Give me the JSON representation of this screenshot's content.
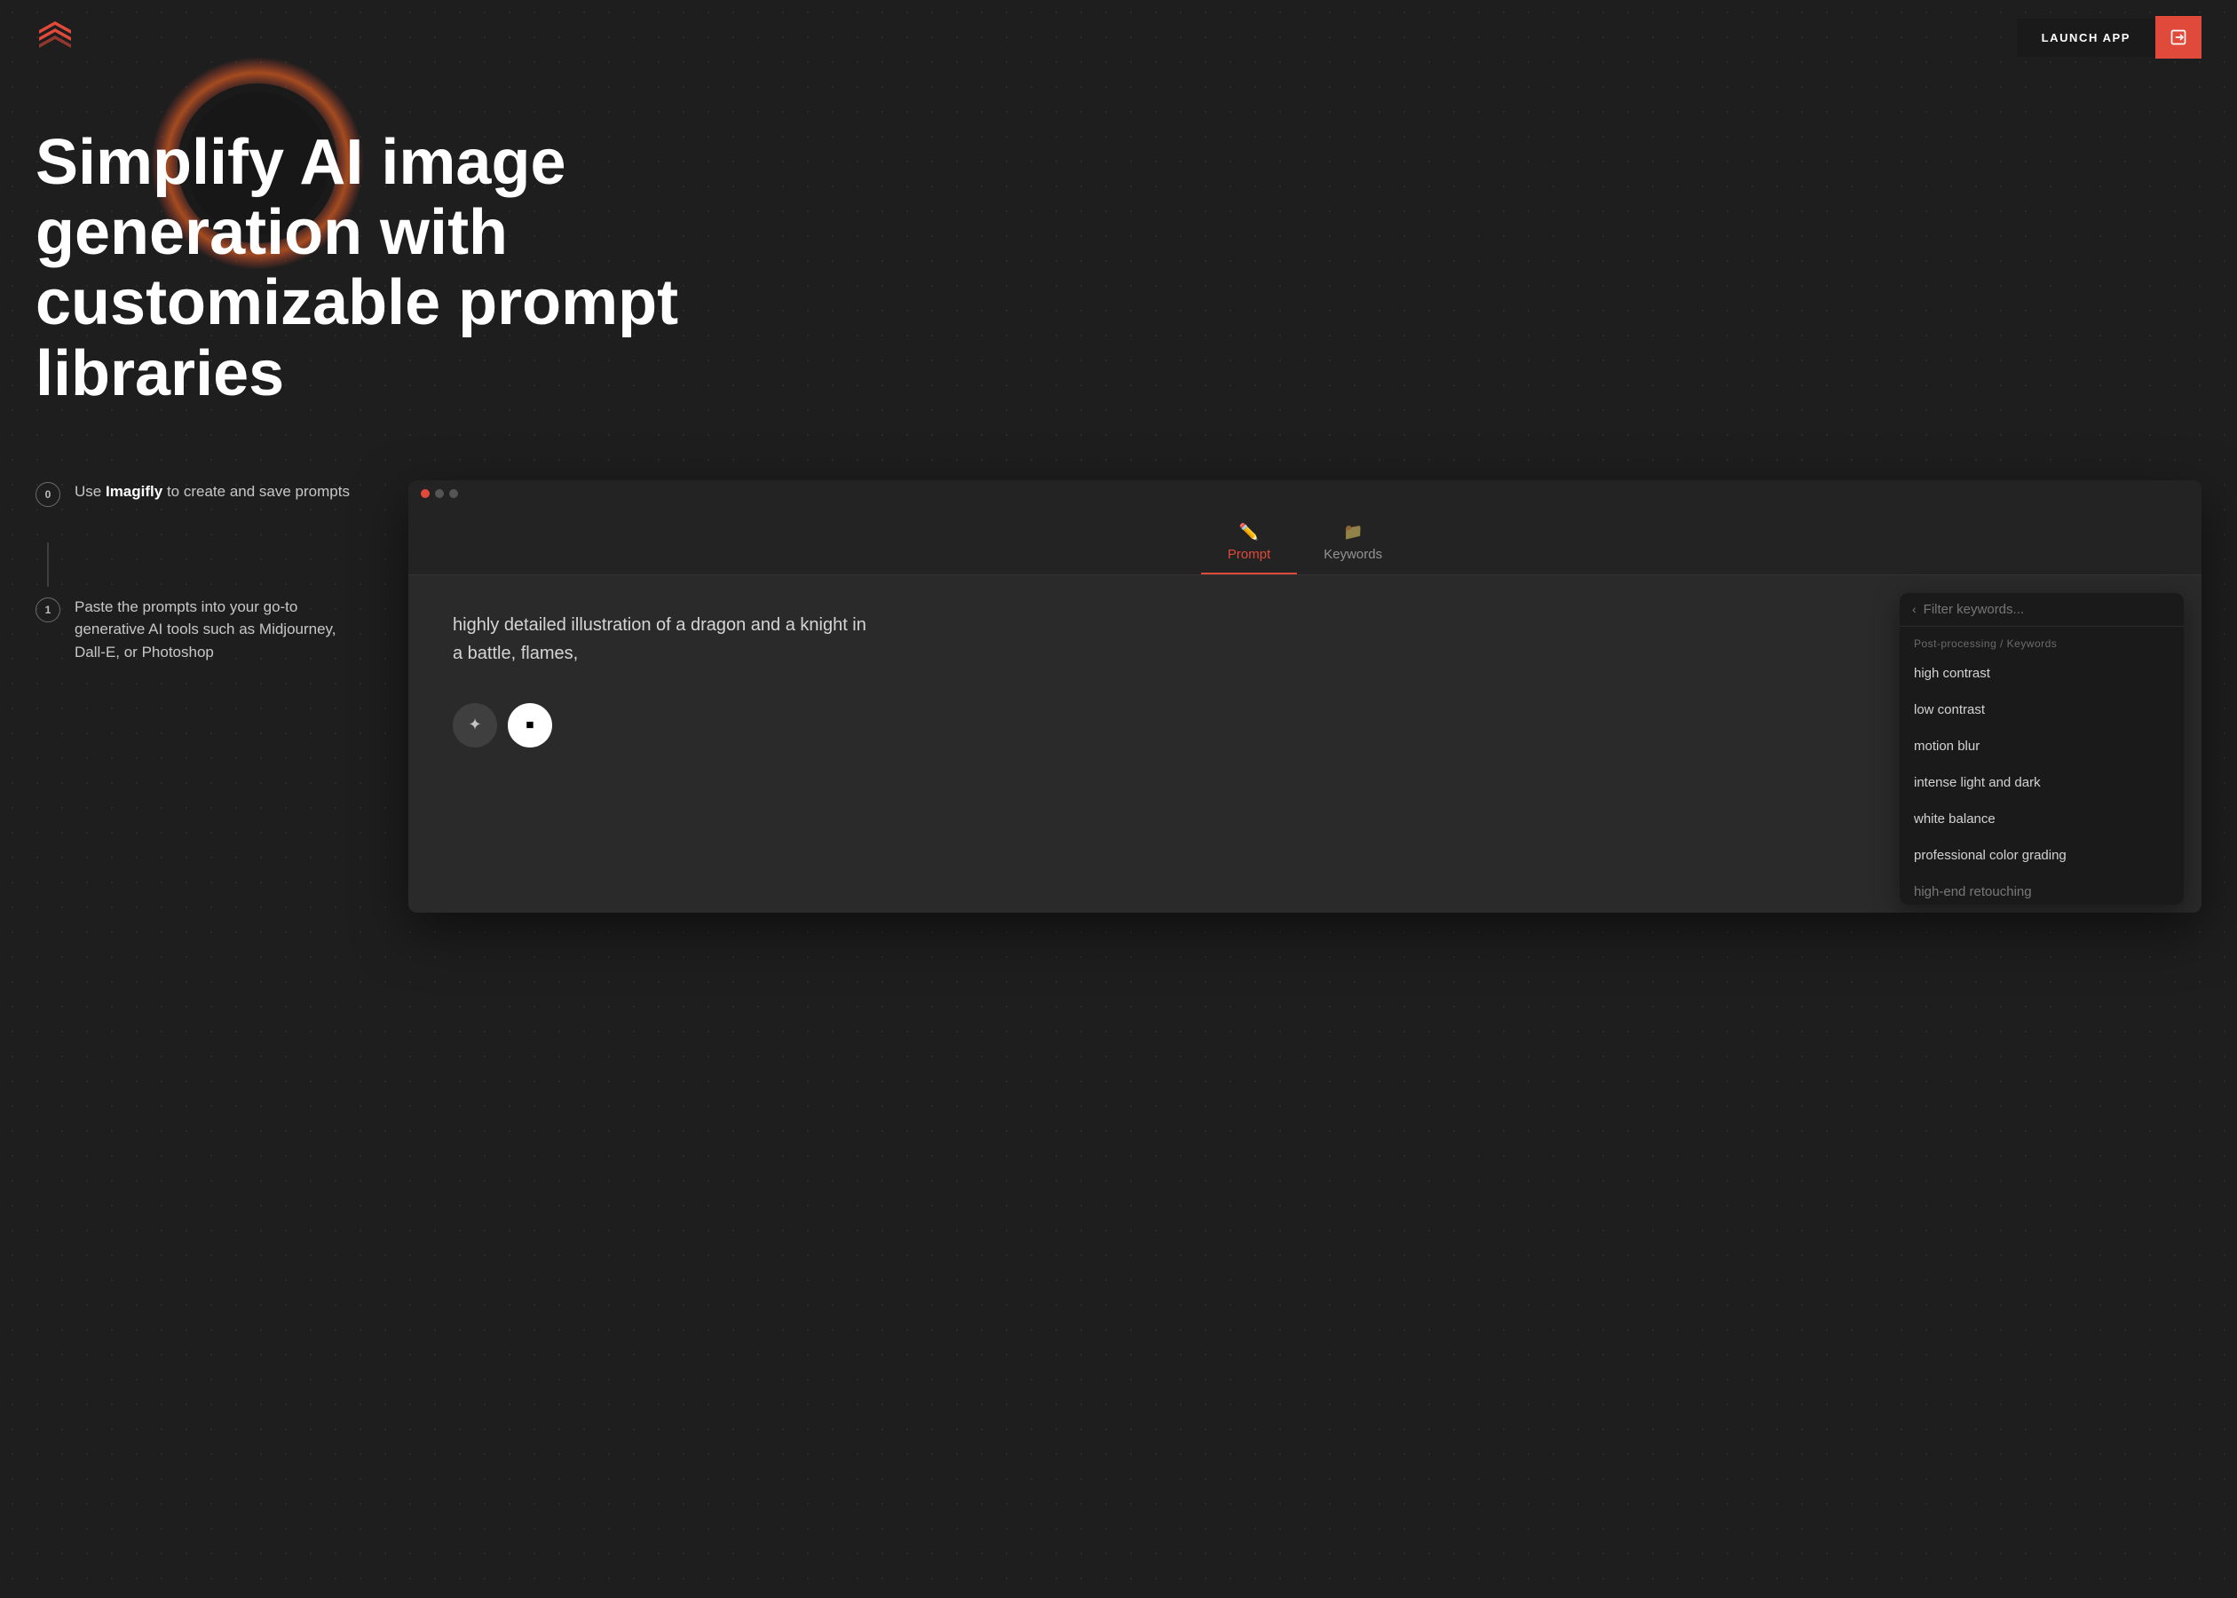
{
  "navbar": {
    "launch_label": "LAUNCH APP"
  },
  "hero": {
    "title_line1": "Simplify AI image generation with",
    "title_line2": "customizable prompt libraries"
  },
  "steps": [
    {
      "badge": "0",
      "text_before": "Use ",
      "brand": "Imagifly",
      "text_after": " to create and save prompts"
    },
    {
      "badge": "1",
      "text": "Paste the prompts into your go-to generative AI tools such as Midjourney, Dall-E, or Photoshop"
    }
  ],
  "app_window": {
    "tabs": [
      {
        "label": "Prompt",
        "active": true
      },
      {
        "label": "Keywords",
        "active": false
      }
    ],
    "prompt_text": "highly detailed illustration of a dragon and a knight in a battle, flames,",
    "filter_placeholder": "Filter keywords...",
    "section_label": "Post-processing / Keywords",
    "keywords": [
      "high contrast",
      "low contrast",
      "motion blur",
      "intense light and dark",
      "white balance",
      "professional color grading",
      "high-end retouching"
    ]
  }
}
